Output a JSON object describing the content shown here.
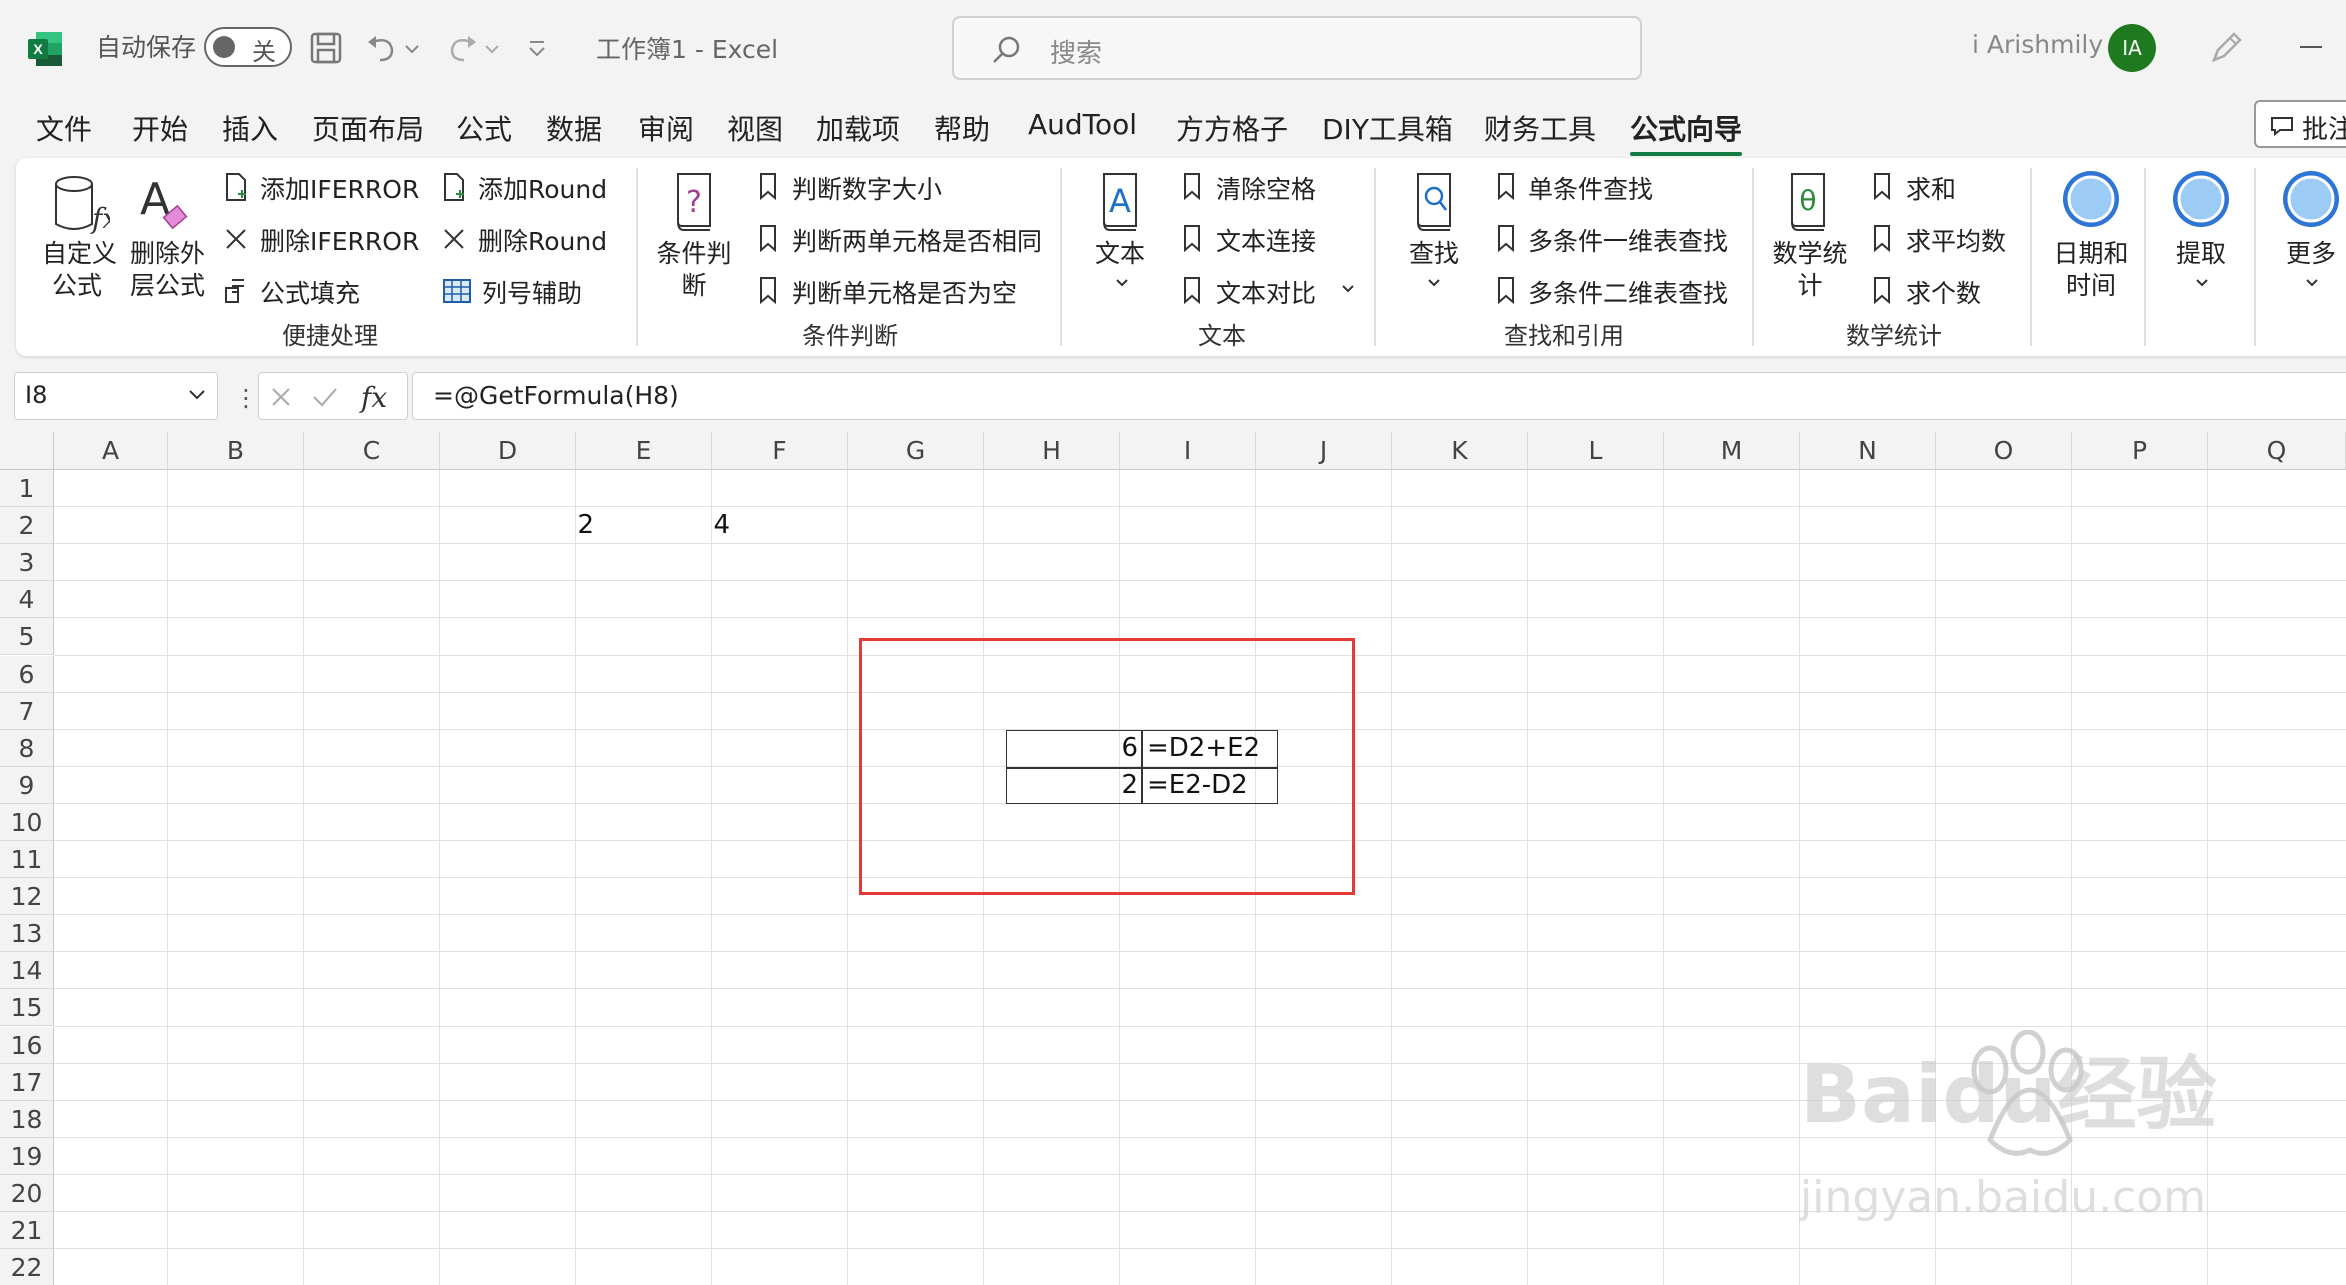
{
  "titlebar": {
    "autosave_label": "自动保存",
    "autosave_state": "关",
    "doc_title": "工作簿1  -  Excel",
    "search_placeholder": "搜索",
    "user_name": "i Arishmily",
    "avatar_initials": "IA"
  },
  "tabs": [
    "文件",
    "开始",
    "插入",
    "页面布局",
    "公式",
    "数据",
    "审阅",
    "视图",
    "加载项",
    "帮助",
    "AudTool",
    "方方格子",
    "DIY工具箱",
    "财务工具",
    "公式向导"
  ],
  "active_tab": "公式向导",
  "comment_button": "批注",
  "ribbon": {
    "group1": {
      "label": "便捷处理",
      "custom_formula": "自定义\n公式",
      "remove_outer": "删除外\n层公式",
      "add_iferror": "添加IFERROR",
      "remove_iferror": "删除IFERROR",
      "formula_fill": "公式填充",
      "add_round": "添加Round",
      "remove_round": "删除Round",
      "col_helper": "列号辅助"
    },
    "group2": {
      "label": "条件判断",
      "cond_big": "条件判\n断",
      "judge_size": "判断数字大小",
      "judge_equal": "判断两单元格是否相同",
      "judge_empty": "判断单元格是否为空"
    },
    "group3": {
      "label": "文本",
      "text_big": "文本",
      "clear_space": "清除空格",
      "text_join": "文本连接",
      "text_compare": "文本对比"
    },
    "group4": {
      "label": "查找和引用",
      "find_big": "查找",
      "single_lookup": "单条件查找",
      "multi_1d": "多条件一维表查找",
      "multi_2d": "多条件二维表查找"
    },
    "group5": {
      "label": "数学统计",
      "math_big": "数学统\n计",
      "sum": "求和",
      "average": "求平均数",
      "count": "求个数"
    },
    "date_time": "日期和\n时间",
    "extract": "提取",
    "more": "更多"
  },
  "formula_bar": {
    "name_box": "I8",
    "formula": "=@GetFormula(H8)"
  },
  "grid": {
    "columns": [
      "A",
      "B",
      "C",
      "D",
      "E",
      "F",
      "G",
      "H",
      "I",
      "J",
      "K",
      "L",
      "M",
      "N",
      "O",
      "P",
      "Q"
    ],
    "rows": [
      "1",
      "2",
      "3",
      "4",
      "5",
      "6",
      "7",
      "8",
      "9",
      "10",
      "11",
      "12",
      "13",
      "14",
      "15",
      "16",
      "17",
      "18",
      "19",
      "20",
      "21",
      "22"
    ],
    "cells": {
      "D2": "2",
      "E2": "4",
      "H8": "6",
      "I8": "=D2+E2",
      "H9": "2",
      "I9": "=E2-D2"
    }
  },
  "watermark": {
    "logo": "Baidu经验",
    "url": "jingyan.baidu.com"
  },
  "colors": {
    "excel_green": "#107c41",
    "highlight_red": "#e53935"
  }
}
